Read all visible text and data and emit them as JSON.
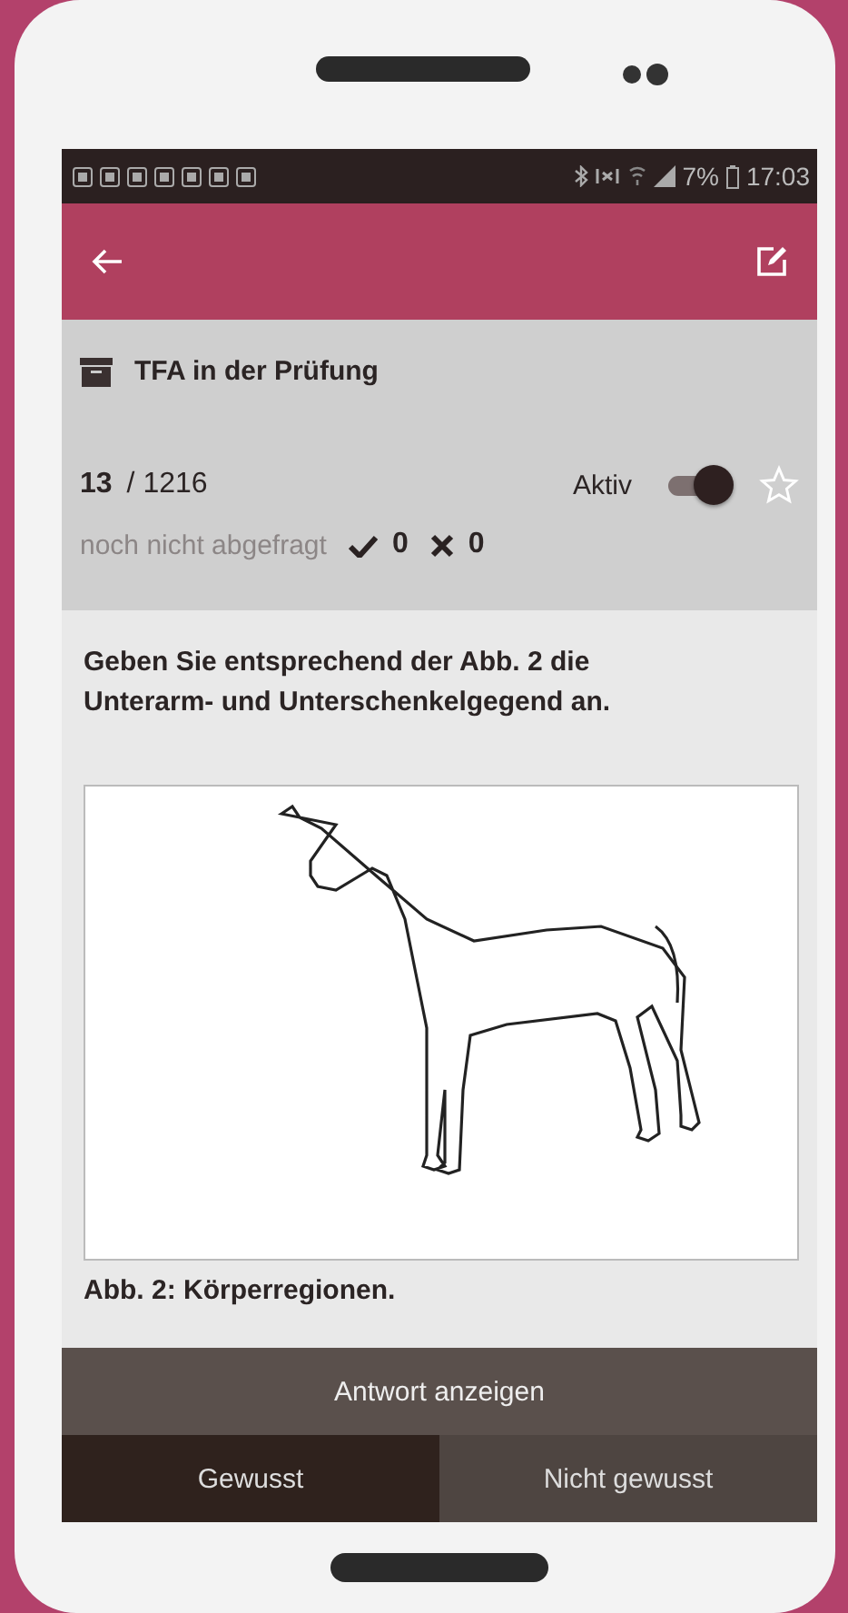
{
  "status_bar": {
    "battery": "7%",
    "time": "17:03"
  },
  "deck": {
    "title": "TFA in der Prüfung"
  },
  "card": {
    "number": "13",
    "total": "/ 1216",
    "active_label": "Aktiv",
    "active": true,
    "starred": false,
    "status": "noch nicht abgefragt",
    "known_count": "0",
    "unknown_count": "0"
  },
  "question": {
    "text": "Geben Sie entsprechend der Abb. 2 die Unterarm- und Unterschenkelgegend an.",
    "caption": "Abb. 2: Körperregionen."
  },
  "show_answer": "Antwort anzeigen",
  "answers": [
    {
      "label": "Gewusst",
      "selected": true
    },
    {
      "label": "Nicht gewusst",
      "selected": false
    }
  ]
}
